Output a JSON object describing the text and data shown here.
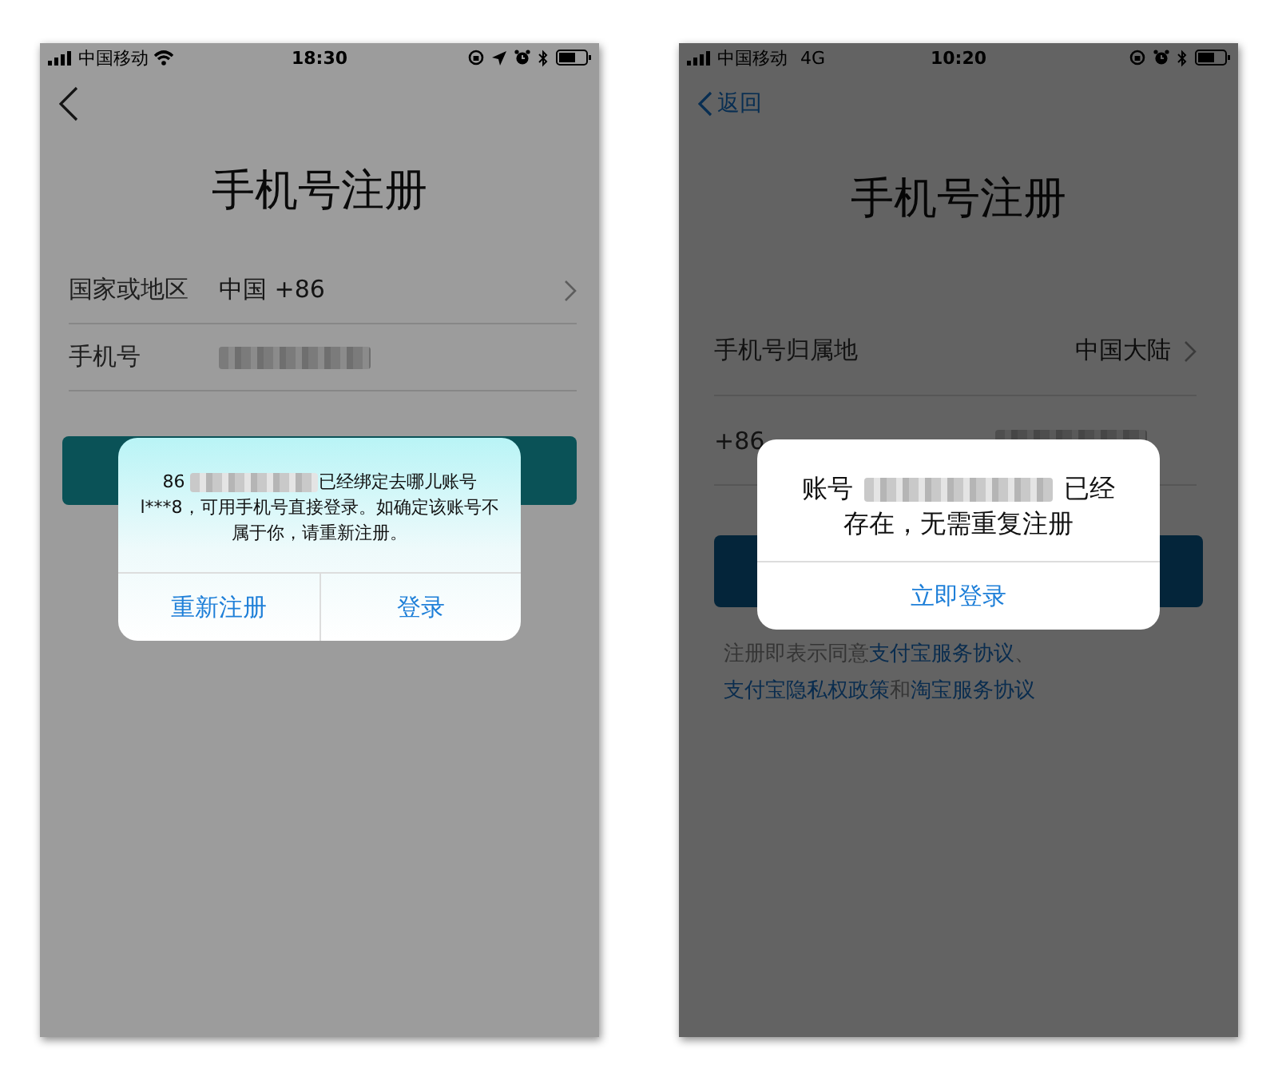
{
  "screens": [
    {
      "kind": "light",
      "status_bar": {
        "carrier": "中国移动",
        "wifi": true,
        "time": "18:30",
        "location": true
      },
      "title": "手机号注册",
      "rows": [
        {
          "kind": "select",
          "label": "国家或地区",
          "value": "中国 +86",
          "chevron": true
        },
        {
          "kind": "input",
          "label": "手机号",
          "redacted": true
        }
      ],
      "dialog": {
        "tinted": true,
        "message": [
          {
            "kind": "text",
            "text": "86 "
          },
          {
            "kind": "redacted"
          },
          {
            "kind": "text",
            "text": "已经绑定去哪儿账号l***8，可用手机号直接登录。如确定该账号不属于你，请重新注册。"
          }
        ],
        "actions": [
          "重新注册",
          "登录"
        ]
      }
    },
    {
      "kind": "dark",
      "status_bar": {
        "carrier": "中国移动",
        "network": "4G",
        "time": "10:20"
      },
      "nav": {
        "back_label": "返回"
      },
      "title": "手机号注册",
      "rows": [
        {
          "kind": "select",
          "label": "手机号归属地",
          "value": "中国大陆",
          "chevron": true
        },
        {
          "kind": "input",
          "label": "+86",
          "redacted": true
        }
      ],
      "agreement": [
        {
          "kind": "text",
          "text": "注册即表示同意"
        },
        {
          "kind": "link",
          "text": "支付宝服务协议"
        },
        {
          "kind": "text",
          "text": "、"
        },
        {
          "kind": "link",
          "text": "支付宝隐私权政策"
        },
        {
          "kind": "text",
          "text": "和"
        },
        {
          "kind": "link",
          "text": "淘宝服务协议"
        }
      ],
      "dialog": {
        "tinted": false,
        "message": [
          {
            "kind": "text",
            "text": "账号 "
          },
          {
            "kind": "redacted"
          },
          {
            "kind": "text",
            "text": " 已经存在，无需重复注册"
          }
        ],
        "actions": [
          "立即登录"
        ]
      }
    }
  ]
}
